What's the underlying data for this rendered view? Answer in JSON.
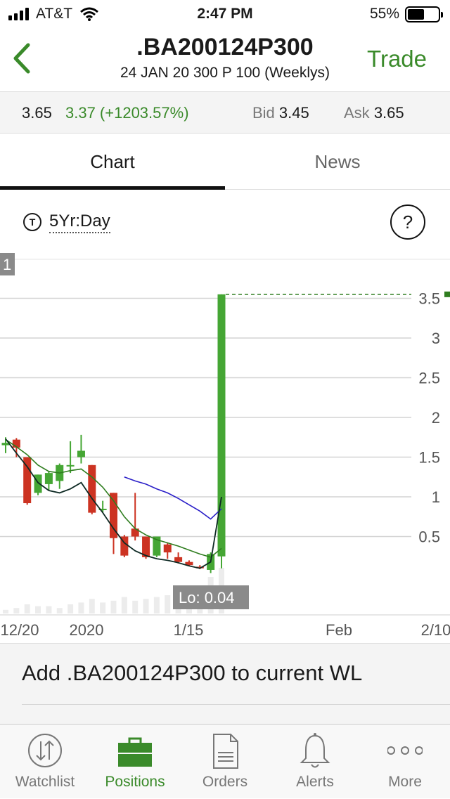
{
  "status_bar": {
    "carrier": "AT&T",
    "time": "2:47 PM",
    "battery_pct": "55%",
    "battery_level": 0.55
  },
  "nav": {
    "title": ".BA200124P300",
    "subtitle": "24 JAN 20 300 P 100 (Weeklys)",
    "trade_label": "Trade",
    "back_icon": "chevron-left-icon",
    "accent_color": "#3a8a2a"
  },
  "quote": {
    "last": "3.65",
    "change": "3.37 (+1203.57%)",
    "bid_label": "Bid",
    "bid": "3.45",
    "ask_label": "Ask",
    "ask": "3.65"
  },
  "tabs": [
    {
      "label": "Chart",
      "active": true
    },
    {
      "label": "News",
      "active": false
    }
  ],
  "chart_toolbar": {
    "t_icon": "T",
    "range": "5Yr:Day",
    "help": "?"
  },
  "chart_data": {
    "type": "candlestick",
    "y_ticks": [
      "3.5",
      "3",
      "2.5",
      "2",
      "1.5",
      "1",
      "0.5"
    ],
    "ylim": [
      0,
      3.6
    ],
    "x_ticks": [
      "12/20",
      "2020",
      "1/15",
      "Feb",
      "2/10"
    ],
    "left_edge_tag": "1",
    "lo_label": "Lo: 0.04",
    "last_price": 3.55,
    "up_color": "#45a634",
    "down_color": "#cc3322",
    "candles": [
      {
        "o": 1.65,
        "h": 1.75,
        "l": 1.55,
        "c": 1.68
      },
      {
        "o": 1.72,
        "h": 1.74,
        "l": 1.5,
        "c": 1.62
      },
      {
        "o": 1.5,
        "h": 1.5,
        "l": 0.9,
        "c": 0.92
      },
      {
        "o": 1.05,
        "h": 1.28,
        "l": 1.02,
        "c": 1.28
      },
      {
        "o": 1.16,
        "h": 1.32,
        "l": 1.08,
        "c": 1.3
      },
      {
        "o": 1.2,
        "h": 1.42,
        "l": 1.1,
        "c": 1.4
      },
      {
        "o": 1.4,
        "h": 1.7,
        "l": 1.3,
        "c": 1.4
      },
      {
        "o": 1.5,
        "h": 1.78,
        "l": 1.42,
        "c": 1.58
      },
      {
        "o": 1.4,
        "h": 1.4,
        "l": 0.78,
        "c": 0.8
      },
      {
        "o": 0.85,
        "h": 0.95,
        "l": 0.8,
        "c": 0.85
      },
      {
        "o": 1.05,
        "h": 1.05,
        "l": 0.28,
        "c": 0.48
      },
      {
        "o": 0.5,
        "h": 0.52,
        "l": 0.24,
        "c": 0.26
      },
      {
        "o": 0.6,
        "h": 1.05,
        "l": 0.45,
        "c": 0.5
      },
      {
        "o": 0.5,
        "h": 0.5,
        "l": 0.22,
        "c": 0.24
      },
      {
        "o": 0.26,
        "h": 0.5,
        "l": 0.24,
        "c": 0.5
      },
      {
        "o": 0.4,
        "h": 0.42,
        "l": 0.22,
        "c": 0.3
      },
      {
        "o": 0.24,
        "h": 0.3,
        "l": 0.16,
        "c": 0.18
      },
      {
        "o": 0.18,
        "h": 0.2,
        "l": 0.13,
        "c": 0.14
      },
      {
        "o": 0.12,
        "h": 0.14,
        "l": 0.09,
        "c": 0.1
      },
      {
        "o": 0.08,
        "h": 0.3,
        "l": 0.04,
        "c": 0.28
      },
      {
        "o": 0.25,
        "h": 3.55,
        "l": 0.1,
        "c": 3.55
      }
    ],
    "ma_black": [
      1.73,
      1.55,
      1.38,
      1.18,
      1.08,
      1.05,
      1.1,
      1.18,
      0.98,
      0.8,
      0.6,
      0.42,
      0.32,
      0.26,
      0.22,
      0.2,
      0.17,
      0.13,
      0.1,
      0.18,
      1.0
    ],
    "ma_green": [
      1.72,
      1.63,
      1.53,
      1.4,
      1.32,
      1.3,
      1.33,
      1.35,
      1.25,
      1.12,
      0.95,
      0.75,
      0.6,
      0.52,
      0.46,
      0.42,
      0.38,
      0.33,
      0.28,
      0.24,
      0.35
    ],
    "ma_blue": [
      null,
      null,
      null,
      null,
      null,
      null,
      null,
      null,
      null,
      null,
      null,
      1.25,
      1.2,
      1.16,
      1.1,
      1.05,
      0.98,
      0.9,
      0.82,
      0.72,
      0.85
    ],
    "volume": [
      0.02,
      0.03,
      0.05,
      0.04,
      0.04,
      0.03,
      0.05,
      0.06,
      0.08,
      0.06,
      0.07,
      0.09,
      0.07,
      0.08,
      0.09,
      0.1,
      0.1,
      0.11,
      0.14,
      0.2,
      0.25
    ]
  },
  "watchlist_prompt": {
    "label": "Add .BA200124P300 to current WL"
  },
  "tab_bar": [
    {
      "label": "Watchlist",
      "icon": "swap-arrows-icon",
      "active": false
    },
    {
      "label": "Positions",
      "icon": "briefcase-icon",
      "active": true
    },
    {
      "label": "Orders",
      "icon": "document-icon",
      "active": false
    },
    {
      "label": "Alerts",
      "icon": "bell-icon",
      "active": false
    },
    {
      "label": "More",
      "icon": "more-dots-icon",
      "active": false
    }
  ]
}
